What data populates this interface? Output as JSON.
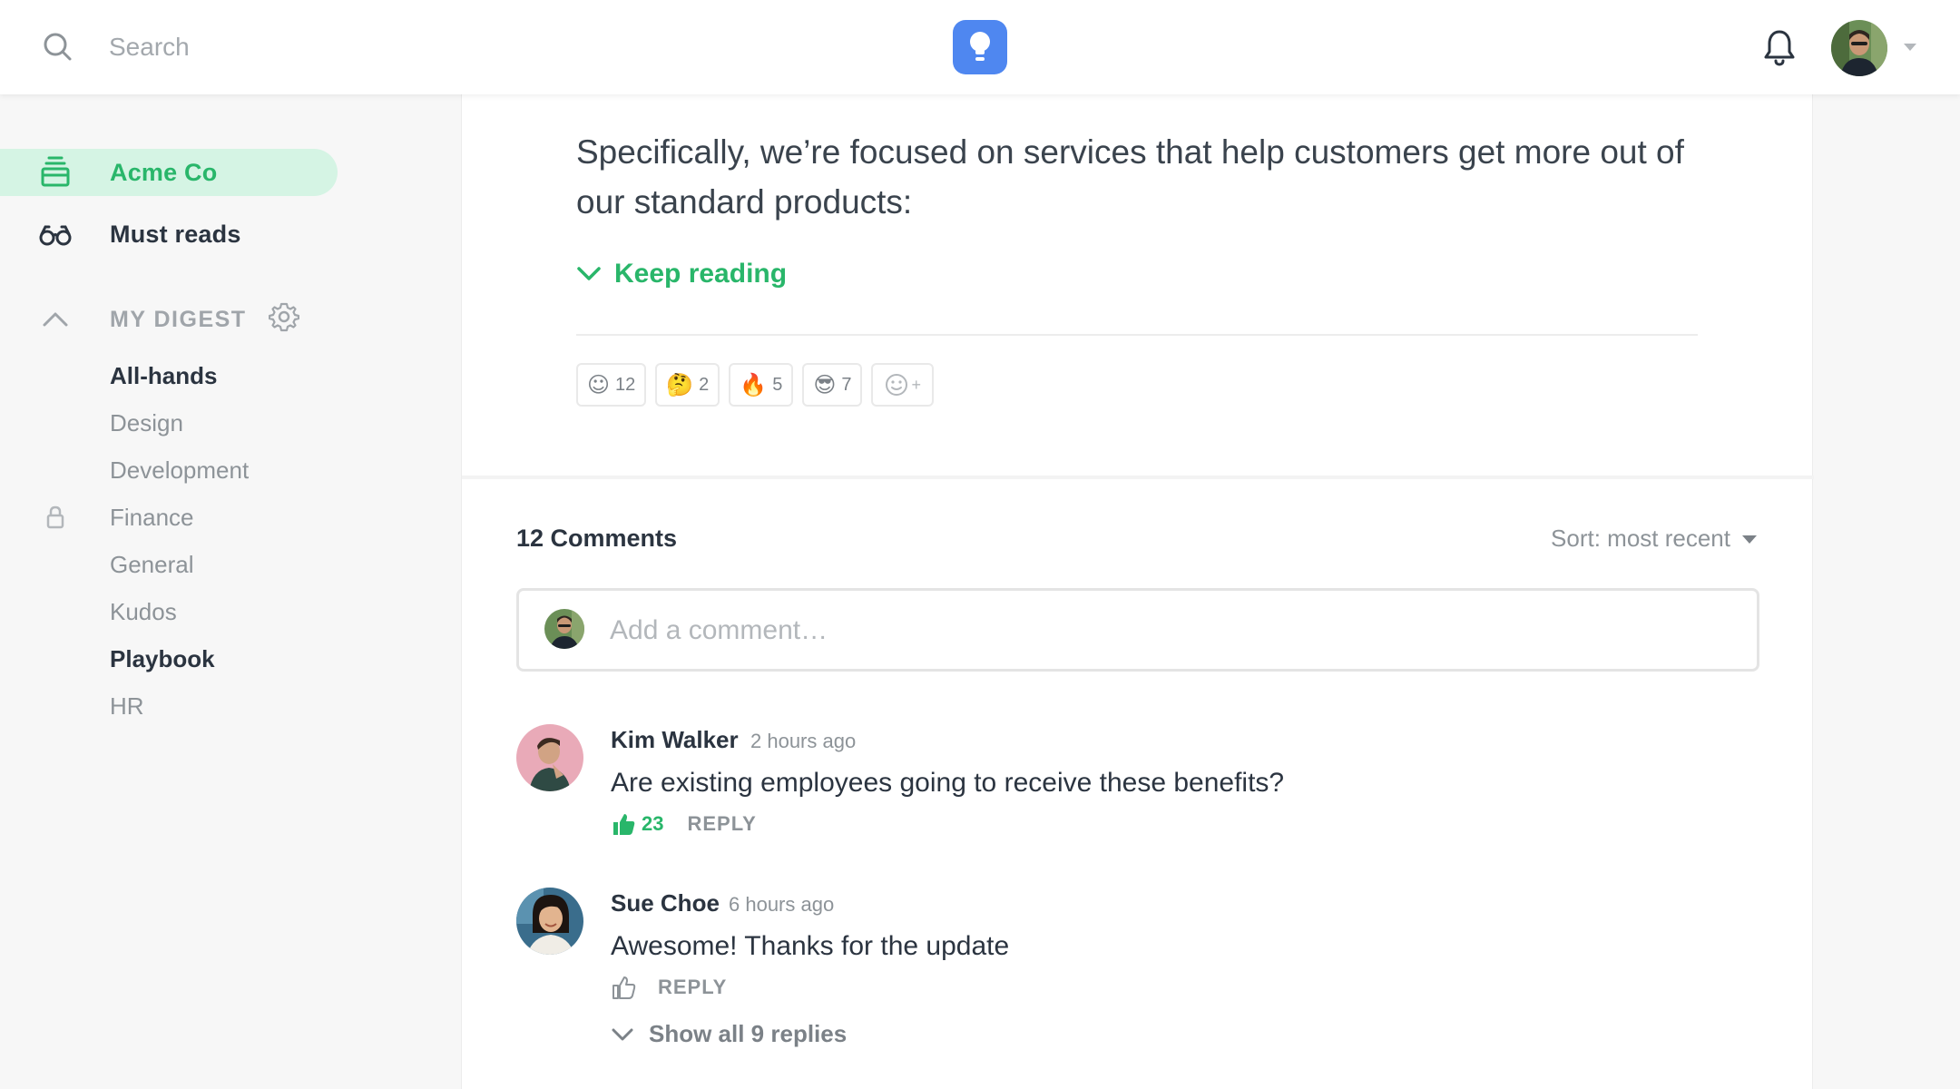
{
  "header": {
    "search_placeholder": "Search",
    "logo_icon": "lightbulb-icon",
    "bell_icon": "bell-icon",
    "avatar_caret_icon": "caret-down-icon"
  },
  "sidebar": {
    "nav": [
      {
        "label": "Acme Co",
        "icon": "inbox-icon",
        "active": true
      },
      {
        "label": "Must reads",
        "icon": "glasses-icon",
        "active": false
      }
    ],
    "digest": {
      "title": "MY DIGEST",
      "collapse_icon": "chevron-up-icon",
      "settings_icon": "gear-icon",
      "channels": [
        {
          "label": "All-hands",
          "bold": true
        },
        {
          "label": "Design",
          "bold": false
        },
        {
          "label": "Development",
          "bold": false
        },
        {
          "label": "Finance",
          "bold": false,
          "locked": true
        },
        {
          "label": "General",
          "bold": false
        },
        {
          "label": "Kudos",
          "bold": false
        },
        {
          "label": "Playbook",
          "bold": true
        },
        {
          "label": "HR",
          "bold": false
        }
      ]
    }
  },
  "article": {
    "text": "Specifically, we’re focused on services that help customers get more out of our standard products:",
    "keep_reading": "Keep reading",
    "reactions": [
      {
        "emoji": "☺",
        "count": "12"
      },
      {
        "emoji": "🤔",
        "count": "2"
      },
      {
        "emoji": "🔥",
        "count": "5"
      },
      {
        "emoji": "😎",
        "count": "7"
      }
    ],
    "add_reaction": "+"
  },
  "comments": {
    "title": "12 Comments",
    "sort_label": "Sort: most recent",
    "input_placeholder": "Add a comment…",
    "items": [
      {
        "author": "Kim Walker",
        "time": "2 hours ago",
        "body": "Are existing employees going to receive these benefits?",
        "likes": "23",
        "liked": true,
        "reply": "REPLY"
      },
      {
        "author": "Sue Choe",
        "time": "6 hours ago",
        "body": "Awesome! Thanks for the update",
        "likes": "",
        "liked": false,
        "reply": "REPLY",
        "show_replies": "Show all 9 replies"
      }
    ]
  },
  "colors": {
    "accent_green": "#29b66a",
    "active_bg": "#d5f4e4",
    "logo_blue": "#4f87f0",
    "text_dark": "#2b3440",
    "text_muted": "#8d9398"
  }
}
